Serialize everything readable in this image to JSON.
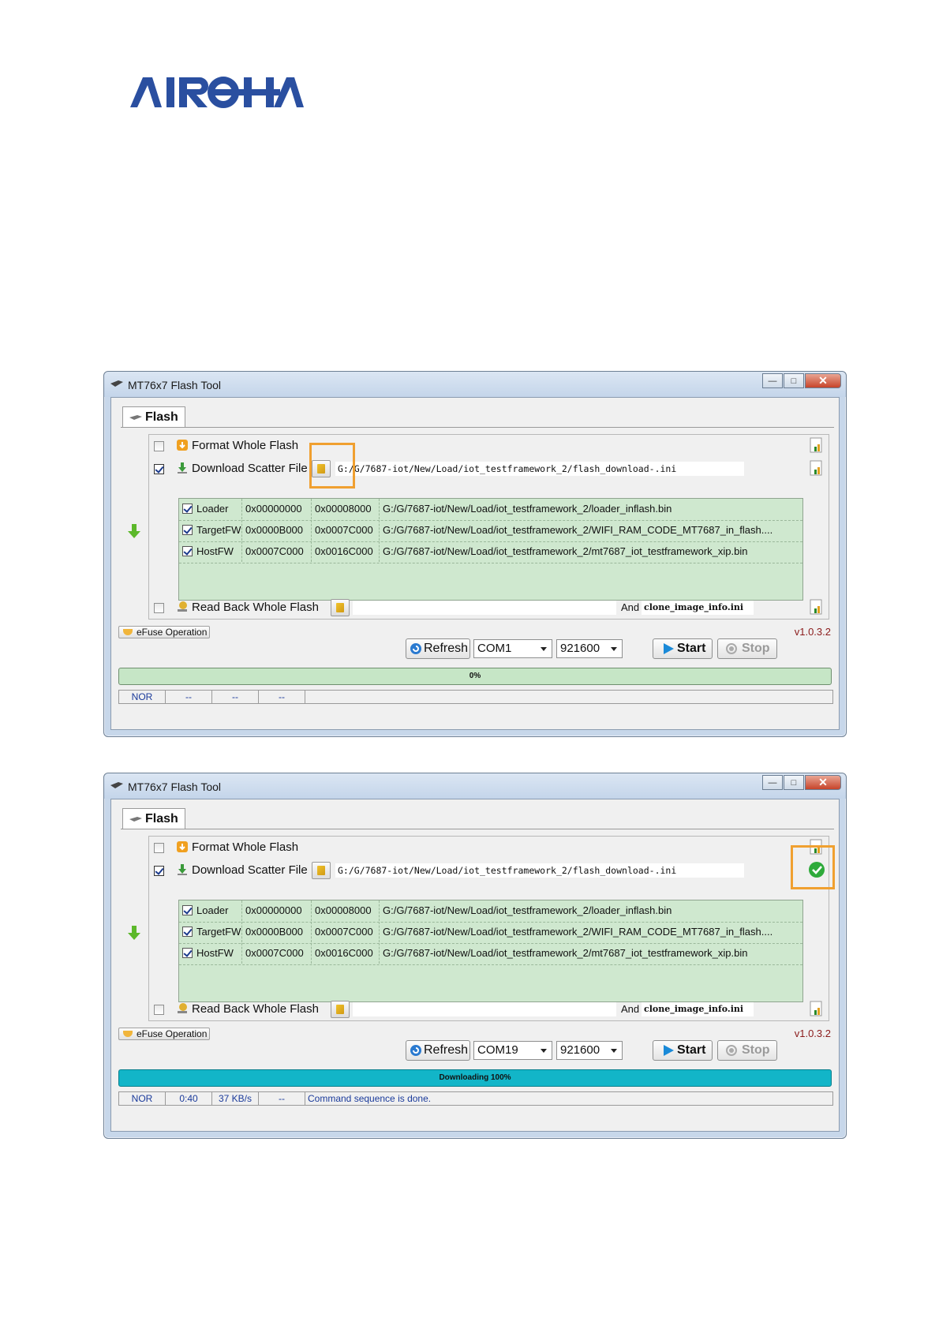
{
  "logo_text": "AIROHA",
  "windows": [
    {
      "title": "MT76x7 Flash Tool",
      "tab": "Flash",
      "format_label": "Format Whole Flash",
      "format_checked": false,
      "scatter_label": "Download Scatter File",
      "scatter_checked": true,
      "scatter_path": "G:/G/7687-iot/New/Load/iot_testframework_2/flash_download-.ini",
      "rows": [
        {
          "name": "Loader",
          "start": "0x00000000",
          "end": "0x00008000",
          "path": "G:/G/7687-iot/New/Load/iot_testframework_2/loader_inflash.bin"
        },
        {
          "name": "TargetFW",
          "start": "0x0000B000",
          "end": "0x0007C000",
          "path": "G:/G/7687-iot/New/Load/iot_testframework_2/WIFI_RAM_CODE_MT7687_in_flash...."
        },
        {
          "name": "HostFW",
          "start": "0x0007C000",
          "end": "0x0016C000",
          "path": "G:/G/7687-iot/New/Load/iot_testframework_2/mt7687_iot_testframework_xip.bin"
        }
      ],
      "readback_label": "Read Back Whole Flash",
      "readback_path": "",
      "and_label": "And",
      "readback_file": "clone_image_info.ini",
      "efuse_label": "eFuse Operation",
      "version": "v1.0.3.2",
      "refresh_label": "Refresh",
      "com_port": "COM1",
      "baud": "921600",
      "start_label": "Start",
      "stop_label": "Stop",
      "progress_text": "0%",
      "progress_value": 0,
      "progress_color": "#c6e6c6",
      "status": [
        "NOR",
        "--",
        "--",
        "--",
        ""
      ],
      "scatter_verified": false
    },
    {
      "title": "MT76x7 Flash Tool",
      "tab": "Flash",
      "format_label": "Format Whole Flash",
      "format_checked": false,
      "scatter_label": "Download Scatter File",
      "scatter_checked": true,
      "scatter_path": "G:/G/7687-iot/New/Load/iot_testframework_2/flash_download-.ini",
      "rows": [
        {
          "name": "Loader",
          "start": "0x00000000",
          "end": "0x00008000",
          "path": "G:/G/7687-iot/New/Load/iot_testframework_2/loader_inflash.bin"
        },
        {
          "name": "TargetFW",
          "start": "0x0000B000",
          "end": "0x0007C000",
          "path": "G:/G/7687-iot/New/Load/iot_testframework_2/WIFI_RAM_CODE_MT7687_in_flash...."
        },
        {
          "name": "HostFW",
          "start": "0x0007C000",
          "end": "0x0016C000",
          "path": "G:/G/7687-iot/New/Load/iot_testframework_2/mt7687_iot_testframework_xip.bin"
        }
      ],
      "readback_label": "Read Back Whole Flash",
      "readback_path": "",
      "and_label": "And",
      "readback_file": "clone_image_info.ini",
      "efuse_label": "eFuse Operation",
      "version": "v1.0.3.2",
      "refresh_label": "Refresh",
      "com_port": "COM19",
      "baud": "921600",
      "start_label": "Start",
      "stop_label": "Stop",
      "progress_text": "Downloading  100%",
      "progress_value": 100,
      "progress_color": "#12b5c8",
      "status": [
        "NOR",
        "0:40",
        "37 KB/s",
        "--",
        "Command sequence is done."
      ],
      "scatter_verified": true
    }
  ],
  "colors": {
    "brand": "#2a4fa0",
    "highlight": "#f0a030",
    "table_bg": "#cfe8cf"
  }
}
